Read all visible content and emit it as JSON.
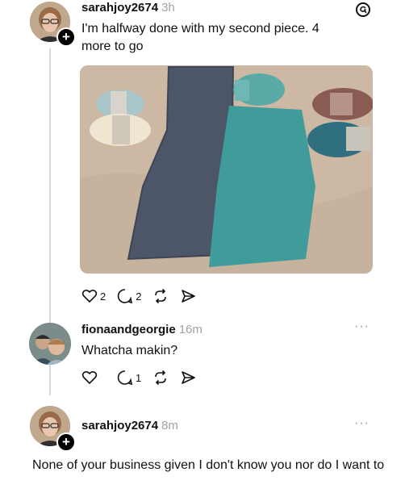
{
  "post": {
    "username": "sarahjoy2674",
    "time": "3h",
    "text": "I'm halfway done with my second piece. 4 more to go",
    "likes": "2",
    "replies": "2",
    "image_alt": "crochet piece with yarn skeins"
  },
  "reply1": {
    "username": "fionaandgeorgie",
    "time": "16m",
    "text": "Whatcha makin?",
    "replies": "1"
  },
  "reply2": {
    "username": "sarahjoy2674",
    "time": "8m",
    "text": "None of your business given I don't know you nor do I want to"
  },
  "icons": [
    "threads-logo-icon",
    "heart-icon",
    "comment-icon",
    "repost-icon",
    "share-icon",
    "more-icon",
    "plus-icon"
  ]
}
